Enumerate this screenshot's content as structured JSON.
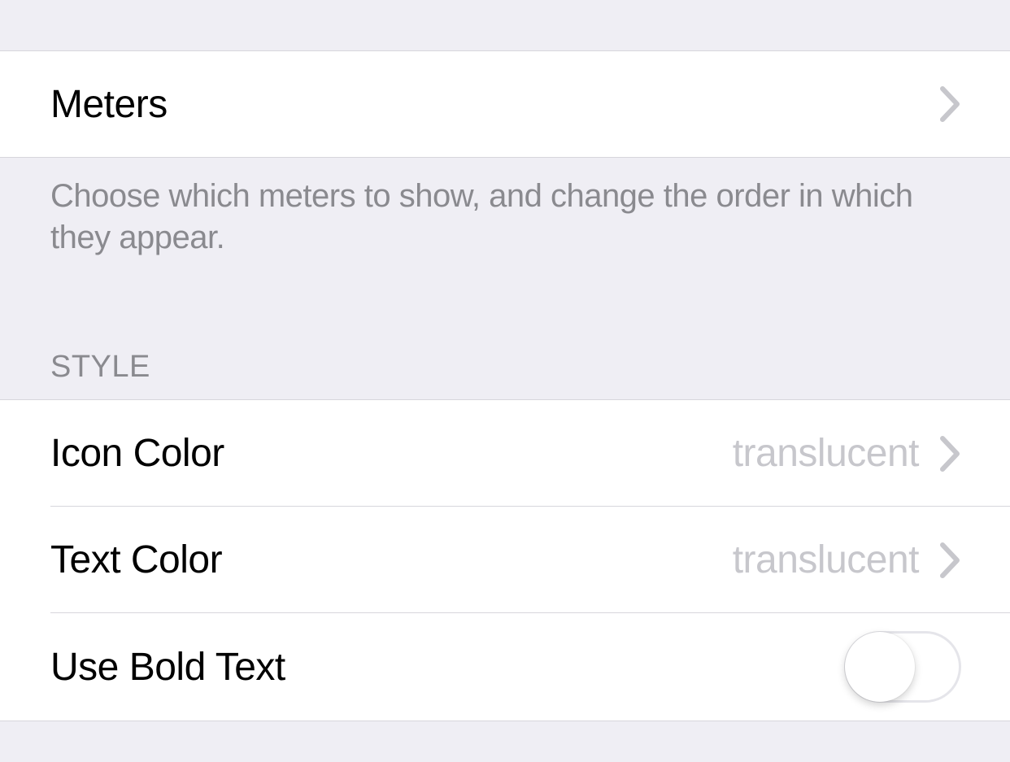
{
  "meters": {
    "label": "Meters",
    "description": "Choose which meters to show, and change the order in which they appear."
  },
  "style": {
    "header": "STYLE",
    "icon_color": {
      "label": "Icon Color",
      "value": "translucent"
    },
    "text_color": {
      "label": "Text Color",
      "value": "translucent"
    },
    "bold_text": {
      "label": "Use Bold Text",
      "enabled": false
    }
  }
}
